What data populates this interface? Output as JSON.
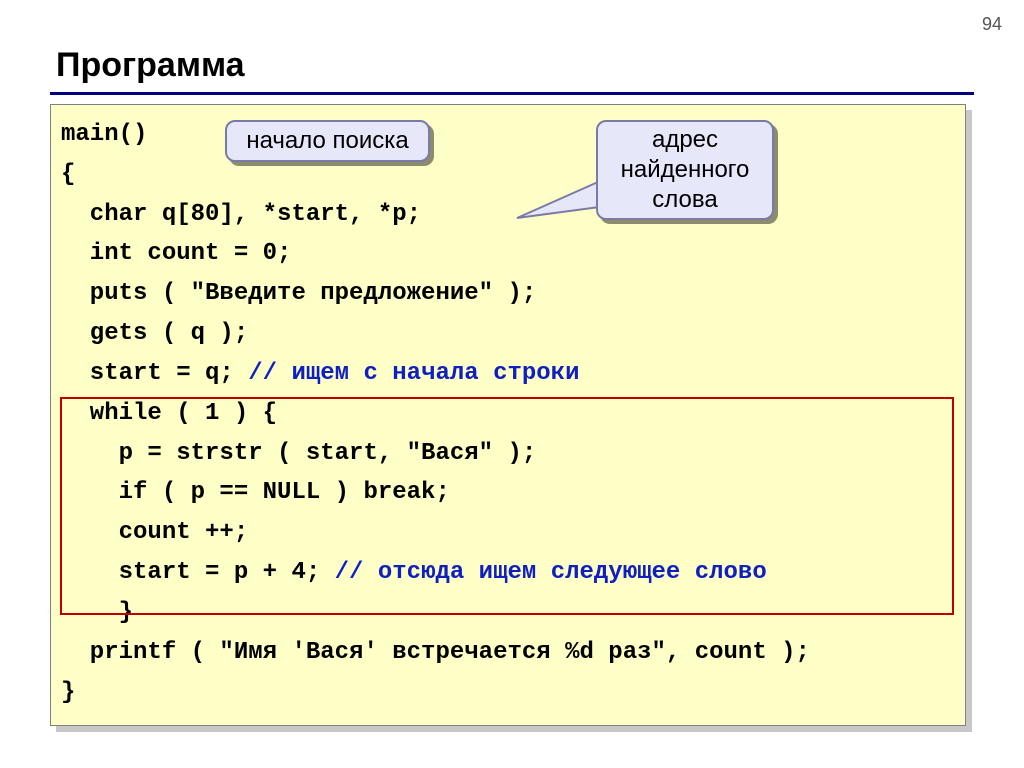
{
  "page_number": "94",
  "title": "Программа",
  "callouts": {
    "start_search": "начало поиска",
    "addr_line1": "адрес",
    "addr_line2": "найденного",
    "addr_line3": "слова"
  },
  "code": {
    "l1": "main()",
    "l2": "{",
    "l3": "  char q[80], *start, *p;",
    "l4": "  int count = 0;",
    "l5": "  puts ( \"Введите предложение\" );",
    "l6": "  gets ( q );",
    "l7a": "  start = q; ",
    "l7b": "// ищем с начала строки",
    "l8": "  while ( 1 ) {",
    "l9": "    p = strstr ( start, \"Вася\" );",
    "l10": "    if ( p == NULL ) break;",
    "l11": "    count ++;",
    "l12a": "    start = p + 4; ",
    "l12b": "// отсюда ищем следующее слово",
    "l13": "    }",
    "l14": "  printf ( \"Имя 'Вася' встречается %d раз\", count );",
    "l15": "}"
  }
}
